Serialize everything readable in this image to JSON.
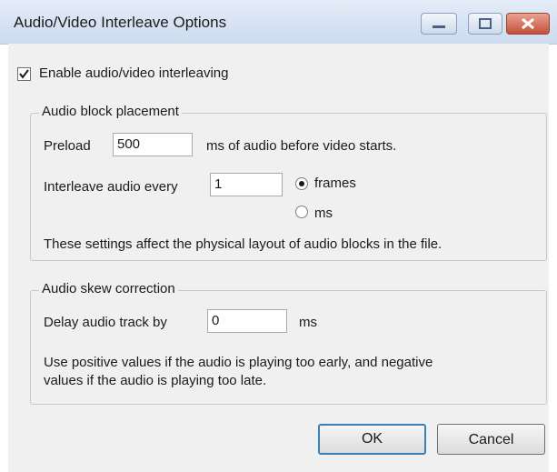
{
  "window": {
    "title": "Audio/Video Interleave Options"
  },
  "enable_interleave": {
    "label": "Enable audio/video interleaving",
    "checked": true
  },
  "audio_block": {
    "group_title": "Audio block placement",
    "preload_label": "Preload",
    "preload_value": "500",
    "preload_suffix": "ms of audio before video starts.",
    "interleave_label": "Interleave audio every",
    "interleave_value": "1",
    "unit_options": [
      "frames",
      "ms"
    ],
    "selected_unit": "frames",
    "note": "These settings affect the physical layout of audio blocks in the file."
  },
  "skew": {
    "group_title": "Audio skew correction",
    "delay_label": "Delay audio track by",
    "delay_value": "0",
    "delay_unit": "ms",
    "note_line1": "Use positive values if the audio is playing too early, and negative",
    "note_line2": "values if the audio is playing too late."
  },
  "buttons": {
    "ok": "OK",
    "cancel": "Cancel"
  }
}
